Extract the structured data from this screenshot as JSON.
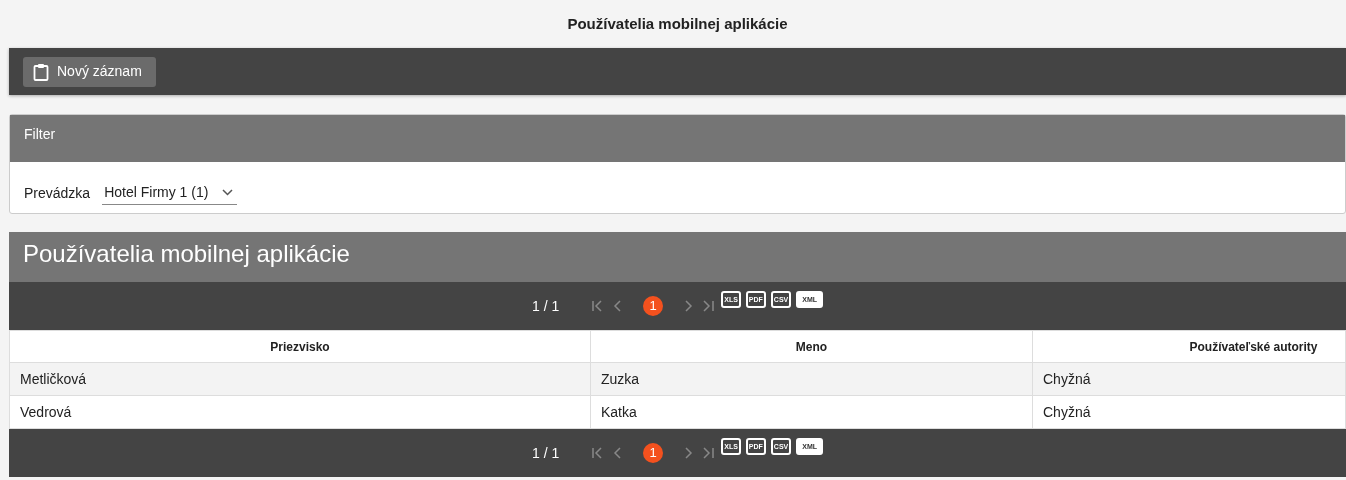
{
  "page_title": "Používatelia mobilnej aplikácie",
  "toolbar": {
    "buttons": [
      {
        "label": "Nový záznam"
      }
    ]
  },
  "filter": {
    "title": "Filter",
    "fields": [
      {
        "label": "Prevádzka",
        "value": "Hotel Firmy 1 (1)"
      }
    ]
  },
  "grid": {
    "title": "Používatelia mobilnej aplikácie",
    "pager_top": {
      "info": "1 / 1",
      "pages": [
        {
          "label": "1",
          "selected": true
        }
      ],
      "exports": [
        "XLS",
        "PDF",
        "CSV",
        "XML"
      ]
    },
    "columns": [
      "Priezvisko",
      "Meno",
      "Používateľské autority"
    ],
    "rows": [
      [
        "Metličková",
        "Zuzka",
        "Chyžná"
      ],
      [
        "Vedrová",
        "Katka",
        "Chyžná"
      ]
    ],
    "pager_bottom": {
      "info": "1 / 1",
      "pages": [
        {
          "label": "1",
          "selected": true
        }
      ],
      "exports": [
        "XLS",
        "PDF",
        "CSV",
        "XML"
      ]
    }
  }
}
